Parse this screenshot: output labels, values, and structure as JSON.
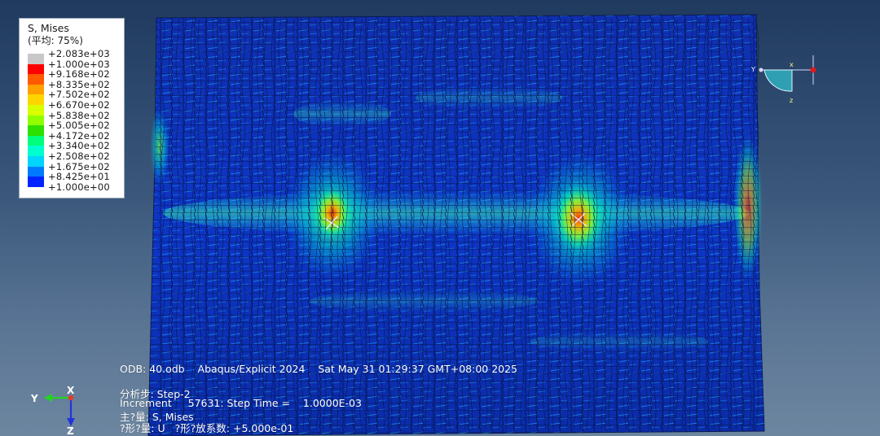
{
  "legend": {
    "title": "S, Mises",
    "subtitle": "(平均: 75%)",
    "levels": [
      {
        "label": "+2.083e+03",
        "color": "#c8c8c8"
      },
      {
        "label": "+1.000e+03",
        "color": "#ff0000"
      },
      {
        "label": "+9.168e+02",
        "color": "#ff5a00"
      },
      {
        "label": "+8.335e+02",
        "color": "#ff9f00"
      },
      {
        "label": "+7.502e+02",
        "color": "#ffd500"
      },
      {
        "label": "+6.670e+02",
        "color": "#d8ff00"
      },
      {
        "label": "+5.838e+02",
        "color": "#8fff00"
      },
      {
        "label": "+5.005e+02",
        "color": "#2ee000"
      },
      {
        "label": "+4.172e+02",
        "color": "#00ff7b"
      },
      {
        "label": "+3.340e+02",
        "color": "#00ffcf"
      },
      {
        "label": "+2.508e+02",
        "color": "#00d4ff"
      },
      {
        "label": "+1.675e+02",
        "color": "#007bff"
      },
      {
        "label": "+8.425e+01",
        "color": "#0024ff"
      },
      {
        "label": "+1.000e+00",
        "color": ""
      }
    ]
  },
  "info": {
    "odb_line": "ODB: 40.odb    Abaqus/Explicit 2024    Sat May 31 01:29:37 GMT+08:00 2025",
    "step_line": "分析步: Step-2",
    "increment_line": "Increment     57631: Step Time =    1.0000E-03",
    "primary_var_line": "主?量: S, Mises",
    "deformed_var_line": "?形?量: U   ?形?放系数: +5.000e-01"
  },
  "triad": {
    "x": "X",
    "y": "Y",
    "z": "Z"
  },
  "view_cube": {
    "x": "x",
    "y": "Y",
    "z": "z"
  },
  "colors": {
    "background_top": "#1f3a5e",
    "background_bottom": "#6d86a0",
    "mesh_base": "#0c2db8",
    "mesh_lines": "#07123a"
  }
}
